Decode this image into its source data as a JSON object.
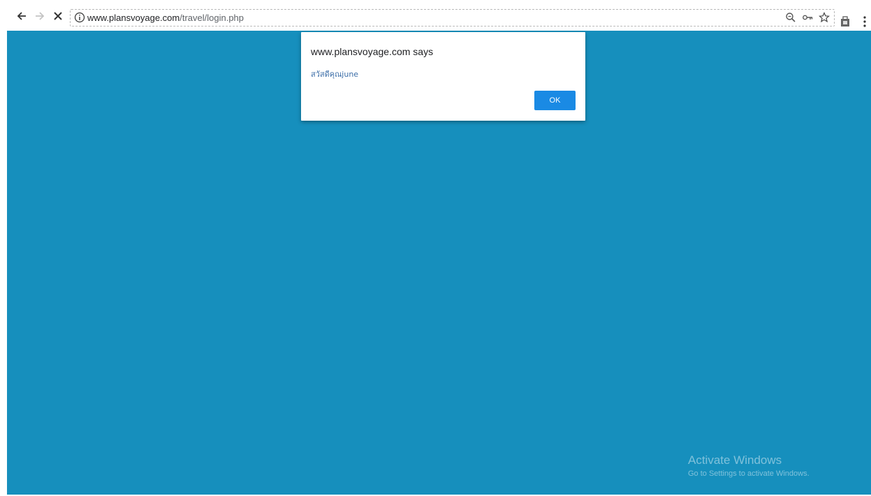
{
  "browser": {
    "url_host": "www.plansvoyage.com",
    "url_path": "/travel/login.php",
    "icons": {
      "back": "back-arrow-icon",
      "forward": "forward-arrow-icon",
      "stop": "stop-loading-icon",
      "info": "site-info-icon",
      "zoom": "zoom-icon",
      "key": "password-key-icon",
      "bookmark": "bookmark-star-icon",
      "extension": "extension-icon",
      "menu": "kebab-menu-icon"
    }
  },
  "dialog": {
    "title": "www.plansvoyage.com says",
    "message": "สวัสดีคุณjune",
    "ok_label": "OK"
  },
  "watermark": {
    "title": "Activate Windows",
    "subtitle": "Go to Settings to activate Windows."
  },
  "colors": {
    "page_background": "#168fbd",
    "ok_button": "#1a8ae4",
    "dialog_message": "#3c6ea8"
  }
}
